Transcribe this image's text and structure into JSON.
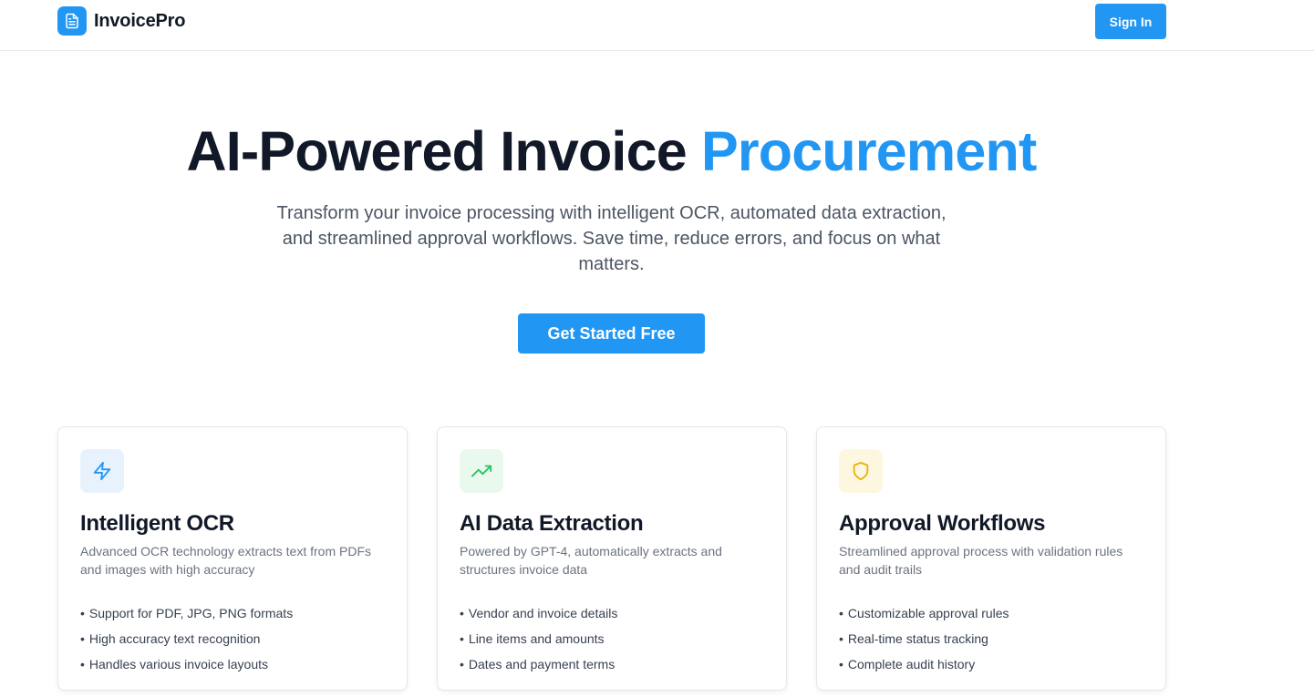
{
  "header": {
    "brand_name": "InvoicePro",
    "signin_label": "Sign In"
  },
  "hero": {
    "title_main": "AI-Powered Invoice",
    "title_accent": "Procurement",
    "subtitle": "Transform your invoice processing with intelligent OCR, automated data extraction, and streamlined approval workflows. Save time, reduce errors, and focus on what matters.",
    "cta_label": "Get Started Free"
  },
  "features": [
    {
      "icon": "lightning-icon",
      "title": "Intelligent OCR",
      "description": "Advanced OCR technology extracts text from PDFs and images with high accuracy",
      "points": [
        "Support for PDF, JPG, PNG formats",
        "High accuracy text recognition",
        "Handles various invoice layouts"
      ]
    },
    {
      "icon": "trending-up-icon",
      "title": "AI Data Extraction",
      "description": "Powered by GPT-4, automatically extracts and structures invoice data",
      "points": [
        "Vendor and invoice details",
        "Line items and amounts",
        "Dates and payment terms"
      ]
    },
    {
      "icon": "shield-icon",
      "title": "Approval Workflows",
      "description": "Streamlined approval process with validation rules and audit trails",
      "points": [
        "Customizable approval rules",
        "Real-time status tracking",
        "Complete audit history"
      ]
    }
  ],
  "colors": {
    "brand": "#2196f3",
    "ocr_icon_bg": "#e8f2fd",
    "extraction_icon": "#22c55e",
    "extraction_icon_bg": "#e9f9ee",
    "workflow_icon": "#eab308",
    "workflow_icon_bg": "#fef7e0"
  }
}
